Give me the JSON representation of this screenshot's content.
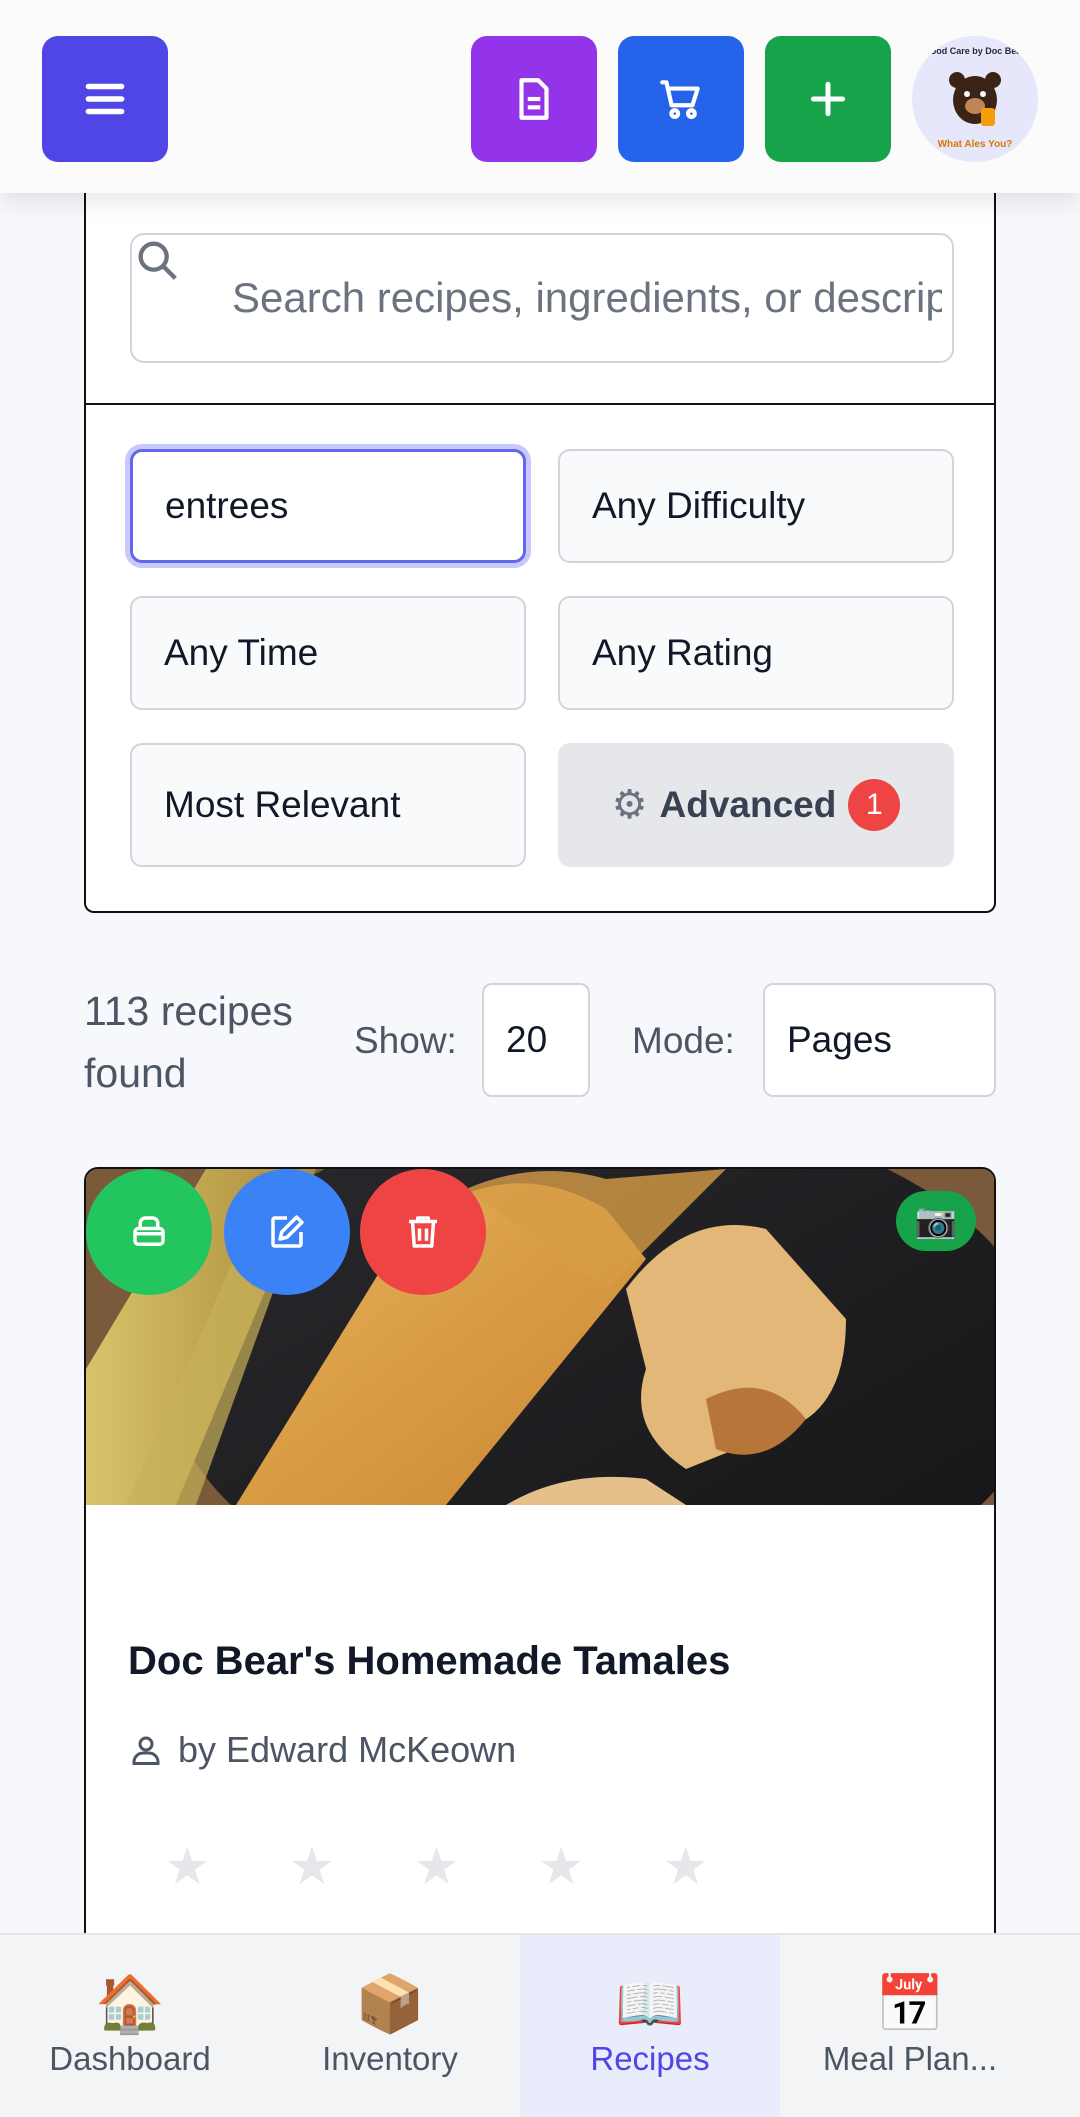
{
  "header": {
    "menu_icon": "hamburger-icon",
    "doc_icon": "document-icon",
    "cart_icon": "cart-icon",
    "add_icon": "plus-icon",
    "logo_top": "Food Care by Doc Bear",
    "logo_bottom": "What Ales You?",
    "colors": {
      "menu": "#4f46e5",
      "doc": "#9333ea",
      "cart": "#2563eb",
      "add": "#16a34a"
    }
  },
  "filters": {
    "search_placeholder": "Search recipes, ingredients, or descriptions...",
    "category": "entrees",
    "difficulty": "Any Difficulty",
    "time": "Any Time",
    "rating": "Any Rating",
    "sort": "Most Relevant",
    "advanced_label": "Advanced",
    "advanced_count": "1"
  },
  "results": {
    "count_label": "113 recipes found",
    "show_label": "Show:",
    "show_value": "20",
    "mode_label": "Mode:",
    "mode_value": "Pages"
  },
  "recipe": {
    "title": "Doc Bear's Homemade Tamales",
    "author": "by Edward McKeown",
    "rating": 0,
    "max_rating": 5
  },
  "nav": {
    "items": [
      {
        "label": "Dashboard",
        "icon": "🏠"
      },
      {
        "label": "Inventory",
        "icon": "📦"
      },
      {
        "label": "Recipes",
        "icon": "📖"
      },
      {
        "label": "Meal Plan...",
        "icon": "📅"
      }
    ],
    "active": "Recipes"
  }
}
